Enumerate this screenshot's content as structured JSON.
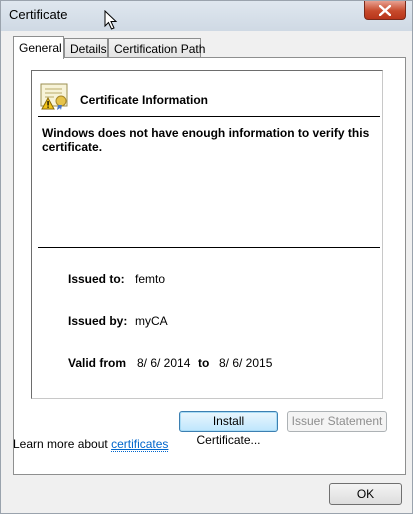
{
  "window": {
    "title": "Certificate"
  },
  "tabs": [
    {
      "label": "General",
      "active": true
    },
    {
      "label": "Details",
      "active": false
    },
    {
      "label": "Certification Path",
      "active": false
    }
  ],
  "certificate": {
    "heading": "Certificate Information",
    "message": "Windows does not have enough information to verify this certificate.",
    "issued_to_label": "Issued to:",
    "issued_to_value": "femto",
    "issued_by_label": "Issued by:",
    "issued_by_value": "myCA",
    "valid_from_label": "Valid from",
    "valid_from_value": "8/ 6/ 2014",
    "valid_to_label": "to",
    "valid_to_value": "8/ 6/ 2015"
  },
  "buttons": {
    "install": "Install Certificate...",
    "issuer_statement": "Issuer Statement",
    "ok": "OK"
  },
  "learn_more": {
    "prefix": "Learn more about",
    "link": "certificates"
  },
  "colors": {
    "link": "#0066cc",
    "close_button": "#c74a2c",
    "focus_border": "#3c7fb1"
  },
  "icons": [
    "close-icon",
    "certificate-warning-icon",
    "mouse-cursor-icon"
  ]
}
